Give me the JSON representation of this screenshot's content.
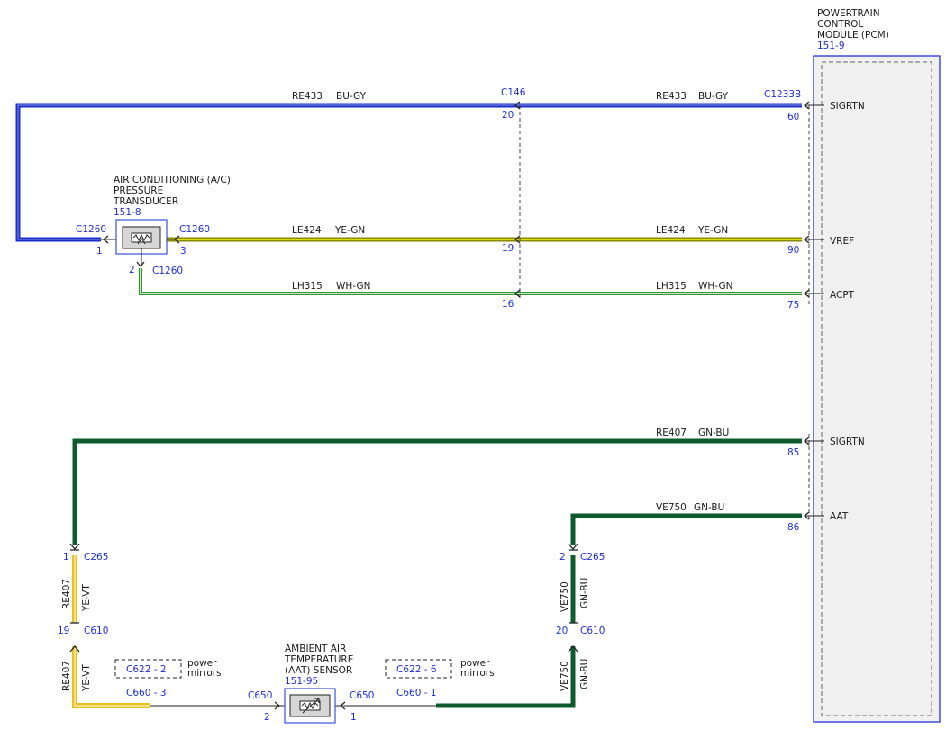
{
  "colors": {
    "bu_gy": "#1a2fd0",
    "ye_gn": "#c8c800",
    "wh_gn": "#2d9a2d",
    "gn_bu": "#0e5c2e",
    "ye_vt": "#e8c21a",
    "connector_text": "#1f2fd8",
    "module_border": "#3a4fe0"
  },
  "pcm": {
    "title_lines": [
      "POWERTRAIN",
      "CONTROL",
      "MODULE (PCM)"
    ],
    "ref": "151-9",
    "pins": {
      "sigrtn1": {
        "label": "SIGRTN",
        "pin": "60"
      },
      "vref": {
        "label": "VREF",
        "pin": "90"
      },
      "acpt": {
        "label": "ACPT",
        "pin": "75"
      },
      "sigrtn2": {
        "label": "SIGRTN",
        "pin": "85"
      },
      "aat": {
        "label": "AAT",
        "pin": "86"
      }
    },
    "connector": "C1233B"
  },
  "ac_transducer": {
    "title_lines": [
      "AIR CONDITIONING (A/C)",
      "PRESSURE",
      "TRANSDUCER"
    ],
    "ref": "151-8",
    "connector": "C1260",
    "pin1": "1",
    "pin2": "2",
    "pin3": "3"
  },
  "c146": {
    "name": "C146",
    "pin_re433": "20",
    "pin_le424": "19",
    "pin_lh315": "16"
  },
  "wires": {
    "re433": {
      "circuit": "RE433",
      "color": "BU-GY"
    },
    "le424": {
      "circuit": "LE424",
      "color": "YE-GN"
    },
    "lh315": {
      "circuit": "LH315",
      "color": "WH-GN"
    },
    "re407": {
      "circuit": "RE407",
      "color": "GN-BU",
      "color_lower": "YE-VT"
    },
    "ve750": {
      "circuit": "VE750",
      "color": "GN-BU"
    }
  },
  "c265": {
    "name": "C265",
    "pin_left": "1",
    "pin_right": "2"
  },
  "c610": {
    "name": "C610",
    "pin_left": "19",
    "pin_right": "20"
  },
  "aat_sensor": {
    "title_lines": [
      "AMBIENT AIR",
      "TEMPERATURE",
      "(AAT) SENSOR"
    ],
    "ref": "151-95",
    "connector": "C650",
    "pin_left": "2",
    "pin_right": "1"
  },
  "splices": {
    "left": {
      "ref": "C622 - 2",
      "note_lines": [
        "power",
        "mirrors"
      ],
      "connector": "C660 -  3"
    },
    "right": {
      "ref": "C622 - 6",
      "note_lines": [
        "power",
        "mirrors"
      ],
      "connector": "C660 -  1"
    }
  }
}
